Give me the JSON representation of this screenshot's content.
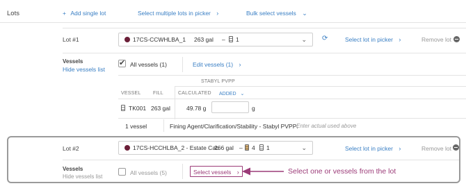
{
  "lots_section": {
    "label": "Lots",
    "add_single_lot": "Add single lot",
    "select_multiple": "Select multiple lots in picker",
    "bulk_select": "Bulk select vessels"
  },
  "lot1": {
    "label": "Lot #1",
    "code": "17CS-CCWHLBA_1",
    "volume": "263 gal",
    "dash": "–",
    "vessel_count": "1",
    "select_in_picker": "Select lot in picker",
    "remove": "Remove lot",
    "vessels_label": "Vessels",
    "hide_vessels": "Hide vessels list",
    "all_vessels": "All vessels (1)",
    "all_vessels_checked": true,
    "edit_vessels": "Edit vessels (1)",
    "table": {
      "col_vessel": "VESSEL",
      "col_fill": "FILL",
      "col_calculated": "CALCULATED",
      "col_added": "ADDED",
      "additive": "STABYL PVPP",
      "row_vessel": "TK001",
      "row_fill": "263 gal",
      "row_calculated": "49.78 g",
      "row_added_value": "",
      "row_unit": "g"
    },
    "footer_count": "1 vessel",
    "footer_desc": "Fining Agent/Clarification/Stability - Stabyl PVPP:",
    "footer_hint": "Enter actual used above"
  },
  "lot2": {
    "label": "Lot #2",
    "code": "17CS-HCCHLBA_2 - Estate Cab",
    "volume": "266 gal",
    "dash": "–",
    "count_a": "4",
    "count_b": "1",
    "select_in_picker": "Select lot in picker",
    "remove": "Remove lot",
    "vessels_label": "Vessels",
    "hide_vessels": "Hide vessels list",
    "all_vessels": "All vessels (5)",
    "all_vessels_checked": false,
    "select_vessels": "Select vessels"
  },
  "annotation": {
    "text": "Select one or vessels from the lot",
    "color": "#9b3b78"
  },
  "colors": {
    "link": "#3a7fc4",
    "lot_dot": "#6b1f38",
    "highlight_border": "#9a9a9a"
  }
}
